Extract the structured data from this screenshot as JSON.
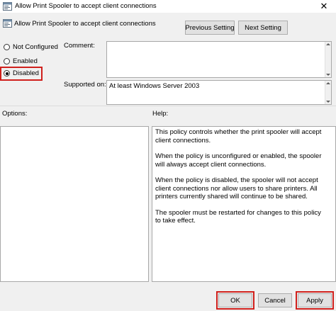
{
  "window": {
    "title": "Allow Print Spooler to accept client connections",
    "close_glyph": "✕"
  },
  "header": {
    "policy_name": "Allow Print Spooler to accept client connections",
    "prev_label": "Previous Setting",
    "next_label": "Next Setting"
  },
  "state": {
    "options": [
      {
        "label": "Not Configured",
        "selected": false
      },
      {
        "label": "Enabled",
        "selected": false
      },
      {
        "label": "Disabled",
        "selected": true
      }
    ]
  },
  "comment": {
    "label": "Comment:",
    "value": ""
  },
  "supported": {
    "label": "Supported on:",
    "value": "At least Windows Server 2003"
  },
  "options_panel": {
    "label": "Options:"
  },
  "help_panel": {
    "label": "Help:",
    "paragraphs": [
      "This policy controls whether the print spooler will accept client connections.",
      "When the policy is unconfigured or enabled, the spooler will always accept client connections.",
      "When the policy is disabled, the spooler will not accept client connections nor allow users to share printers.  All printers currently shared will continue to be shared.",
      "The spooler must be restarted for changes to this policy to take effect."
    ]
  },
  "footer": {
    "ok_label": "OK",
    "cancel_label": "Cancel",
    "apply_label": "Apply"
  },
  "colors": {
    "highlight": "#d0201c",
    "window_bg": "#f0f0f0",
    "button_bg": "#e1e1e1"
  }
}
